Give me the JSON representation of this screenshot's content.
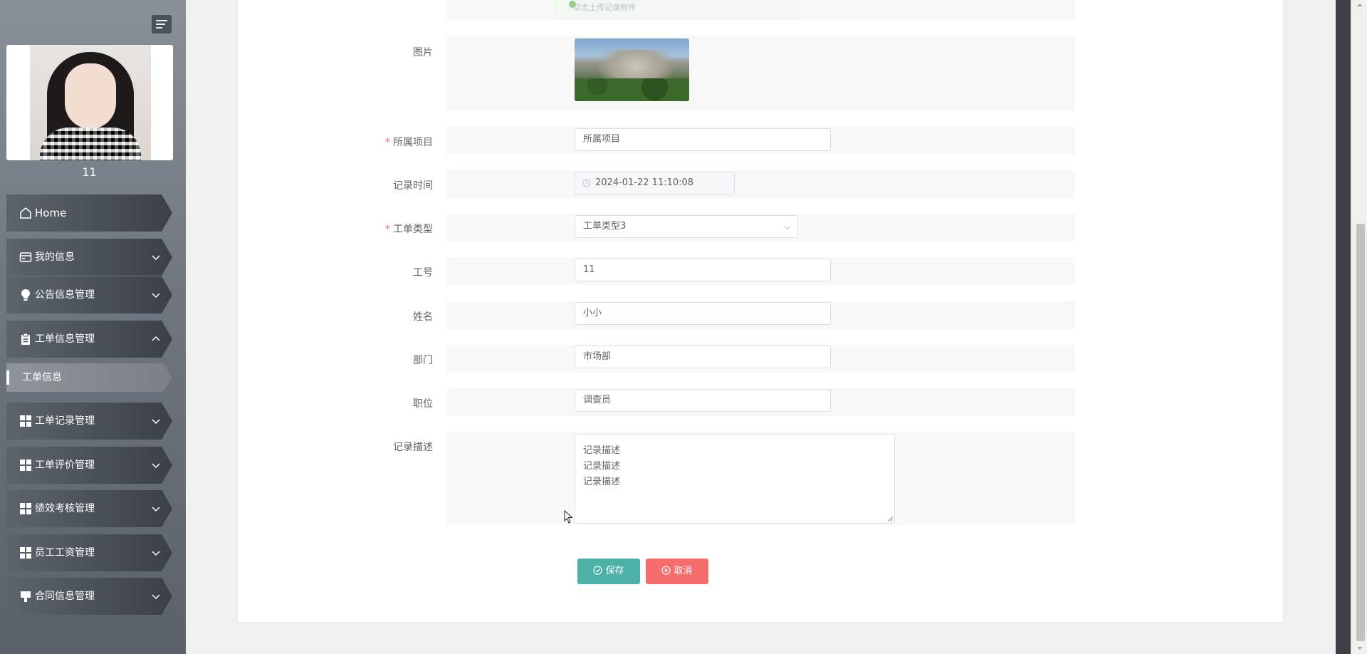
{
  "sidebar": {
    "user_name": "11",
    "menu": [
      {
        "label": "Home",
        "icon": "home-icon",
        "chevron": ""
      },
      {
        "label": "我的信息",
        "icon": "id-card-icon",
        "chevron": "down"
      },
      {
        "label": "公告信息管理",
        "icon": "bulb-icon",
        "chevron": "down"
      },
      {
        "label": "工单信息管理",
        "icon": "clipboard-icon",
        "chevron": "up"
      },
      {
        "label": "工单记录管理",
        "icon": "grid-icon",
        "chevron": "down"
      },
      {
        "label": "工单评价管理",
        "icon": "grid-icon",
        "chevron": "down"
      },
      {
        "label": "绩效考核管理",
        "icon": "grid-icon",
        "chevron": "down"
      },
      {
        "label": "员工工资管理",
        "icon": "grid-icon",
        "chevron": "down"
      },
      {
        "label": "合同信息管理",
        "icon": "stamp-icon",
        "chevron": "down"
      }
    ],
    "submenu": {
      "label": "工单信息"
    }
  },
  "form": {
    "upload_hint": "点击上传记录附件",
    "picture": {
      "label": "图片"
    },
    "project": {
      "label": "所属项目",
      "required": "*",
      "value": "所属项目"
    },
    "record_time": {
      "label": "记录时间",
      "value": "2024-01-22 11:10:08"
    },
    "ticket_type": {
      "label": "工单类型",
      "required": "*",
      "value": "工单类型3"
    },
    "employee_no": {
      "label": "工号",
      "value": "11"
    },
    "name": {
      "label": "姓名",
      "value": "小小"
    },
    "department": {
      "label": "部门",
      "value": "市场部"
    },
    "position": {
      "label": "职位",
      "value": "调查员"
    },
    "description": {
      "label": "记录描述",
      "lines": [
        "记录描述",
        "记录描述",
        "记录描述"
      ]
    },
    "save_label": "保存",
    "cancel_label": "取消"
  },
  "colors": {
    "save": "#4cb2a7",
    "cancel": "#f56c6c",
    "required": "#f56c6c"
  }
}
